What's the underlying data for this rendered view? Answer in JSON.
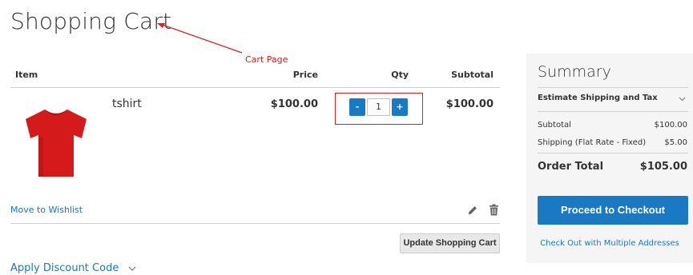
{
  "page": {
    "title": "Shopping Cart"
  },
  "annotation": {
    "label": "Cart Page",
    "color": "#e02020"
  },
  "table": {
    "headers": {
      "item": "Item",
      "price": "Price",
      "qty": "Qty",
      "subtotal": "Subtotal"
    }
  },
  "cart_item": {
    "name": "tshirt",
    "image_icon": "red-tshirt",
    "price": "$100.00",
    "qty": "1",
    "qty_minus": "-",
    "qty_plus": "+",
    "subtotal": "$100.00"
  },
  "actions": {
    "move_to_wishlist": "Move to Wishlist",
    "edit_icon": "pencil-icon",
    "delete_icon": "trash-icon",
    "update_cart": "Update Shopping Cart",
    "apply_discount": "Apply Discount Code"
  },
  "summary": {
    "title": "Summary",
    "estimate_shipping": "Estimate Shipping and Tax",
    "subtotal_label": "Subtotal",
    "subtotal_value": "$100.00",
    "shipping_label": "Shipping (Flat Rate - Fixed)",
    "shipping_value": "$5.00",
    "order_total_label": "Order Total",
    "order_total_value": "$105.00",
    "checkout_button": "Proceed to Checkout",
    "multi_address_link": "Check Out with Multiple Addresses"
  },
  "colors": {
    "accent": "#1979c3",
    "annotation": "#e02020",
    "summary_bg": "#f5f5f5"
  }
}
